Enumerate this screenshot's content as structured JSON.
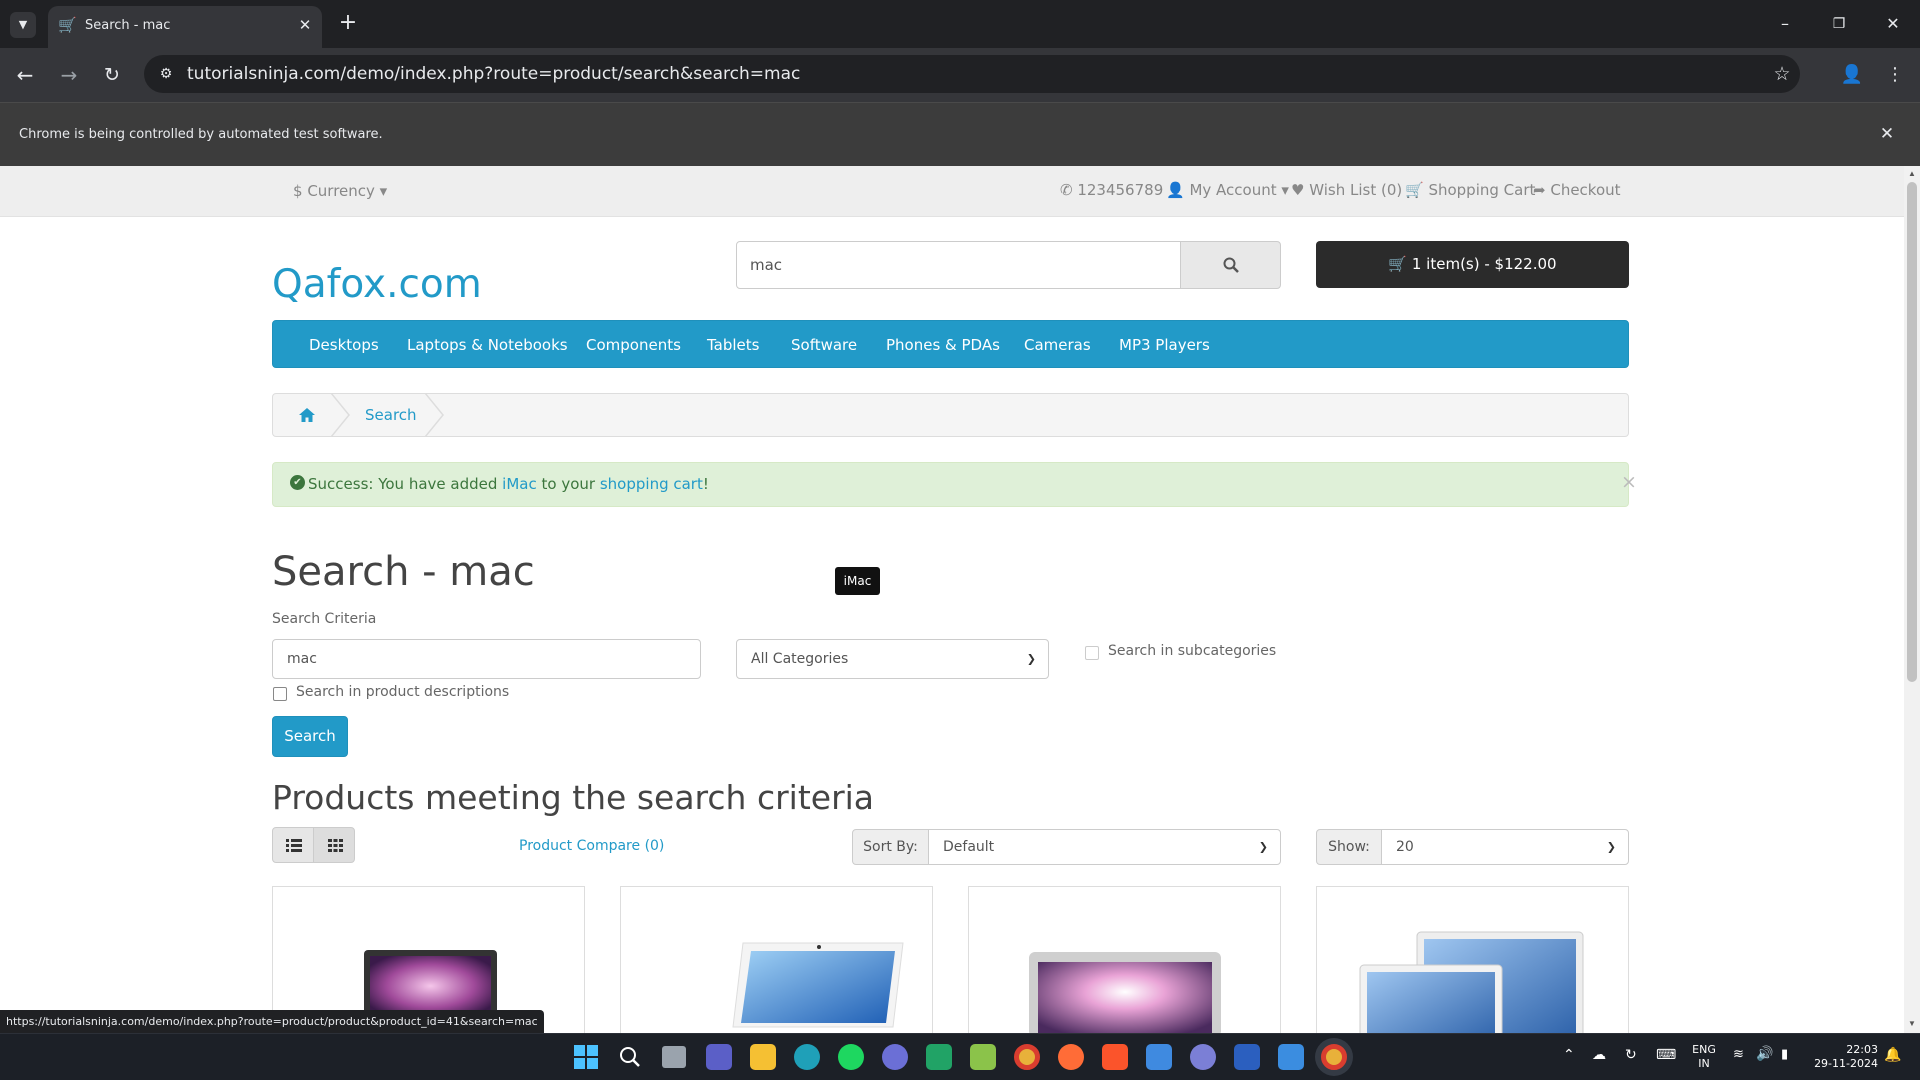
{
  "browser": {
    "tab_title": "Search - mac",
    "url": "tutorialsninja.com/demo/index.php?route=product/search&search=mac",
    "infobar": "Chrome is being controlled by automated test software.",
    "status_url": "https://tutorialsninja.com/demo/index.php?route=product/product&product_id=41&search=mac"
  },
  "topbar": {
    "currency": "Currency",
    "phone": "123456789",
    "my_account": "My Account",
    "wish_list": "Wish List (0)",
    "shopping_cart": "Shopping Cart",
    "checkout": "Checkout"
  },
  "header": {
    "logo": "Qafox.com",
    "search_value": "mac",
    "cart_button": "1 item(s) - $122.00"
  },
  "menu": [
    "Desktops",
    "Laptops & Notebooks",
    "Components",
    "Tablets",
    "Software",
    "Phones & PDAs",
    "Cameras",
    "MP3 Players"
  ],
  "breadcrumb": {
    "current": "Search"
  },
  "alert": {
    "prefix": "Success: You have added",
    "product": "iMac",
    "middle": "to your",
    "cart_link": "shopping cart",
    "suffix": "!",
    "close": "×"
  },
  "search": {
    "heading": "Search - mac",
    "tooltip": "iMac",
    "criteria_label": "Search Criteria",
    "keyword": "mac",
    "category": "All Categories",
    "subcategories_label": "Search in subcategories",
    "descriptions_label": "Search in product descriptions",
    "button": "Search"
  },
  "results": {
    "heading": "Products meeting the search criteria",
    "compare_link": "Product Compare (0)",
    "sort_label": "Sort By:",
    "sort_value": "Default",
    "show_label": "Show:",
    "show_value": "20"
  },
  "taskbar": {
    "lang_top": "ENG",
    "lang_bottom": "IN",
    "time": "22:03",
    "date": "29-11-2024"
  }
}
